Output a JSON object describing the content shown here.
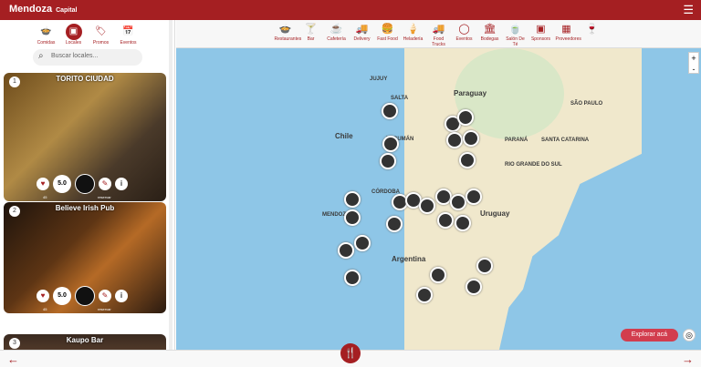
{
  "header": {
    "brand": "Mendoza",
    "subbrand": "Capital"
  },
  "sidebar": {
    "tabs": [
      "Comidas",
      "Locales",
      "Promos",
      "Eventos"
    ],
    "search_placeholder": "Buscar locales...",
    "cards": [
      {
        "num": "1",
        "title": "TORITO CIUDAD",
        "score": "5.0",
        "likes": "45",
        "reserve": "reservar"
      },
      {
        "num": "2",
        "title": "Believe Irish Pub",
        "score": "5.0",
        "likes": "45",
        "reserve": "reservar"
      },
      {
        "num": "3",
        "title": "Kaupo Bar"
      }
    ]
  },
  "map": {
    "categories": [
      "Restaurantes",
      "Bar",
      "Cafetería",
      "Delivery",
      "Fast Food",
      "Heladería",
      "Food Trucks",
      "Eventos",
      "Bodegas",
      "Salón De Té",
      "Sponsors",
      "Proveedores",
      ""
    ],
    "labels": {
      "paraguay": "Paraguay",
      "chile": "Chile",
      "argentina": "Argentina",
      "uruguay": "Uruguay",
      "parana": "PARANÁ",
      "santacatarina": "SANTA CATARINA",
      "riogrande": "RIO GRANDE DO SUL",
      "saopaulo": "SÃO PAULO",
      "tucuman": "TUCUMÁN",
      "salta": "SALTA",
      "jujuy": "JUJUY",
      "cordoba": "CÓRDOBA",
      "mendoza": "MENDOZA"
    },
    "explore": "Explorar acá",
    "zoom": {
      "in": "+",
      "out": "-"
    }
  }
}
